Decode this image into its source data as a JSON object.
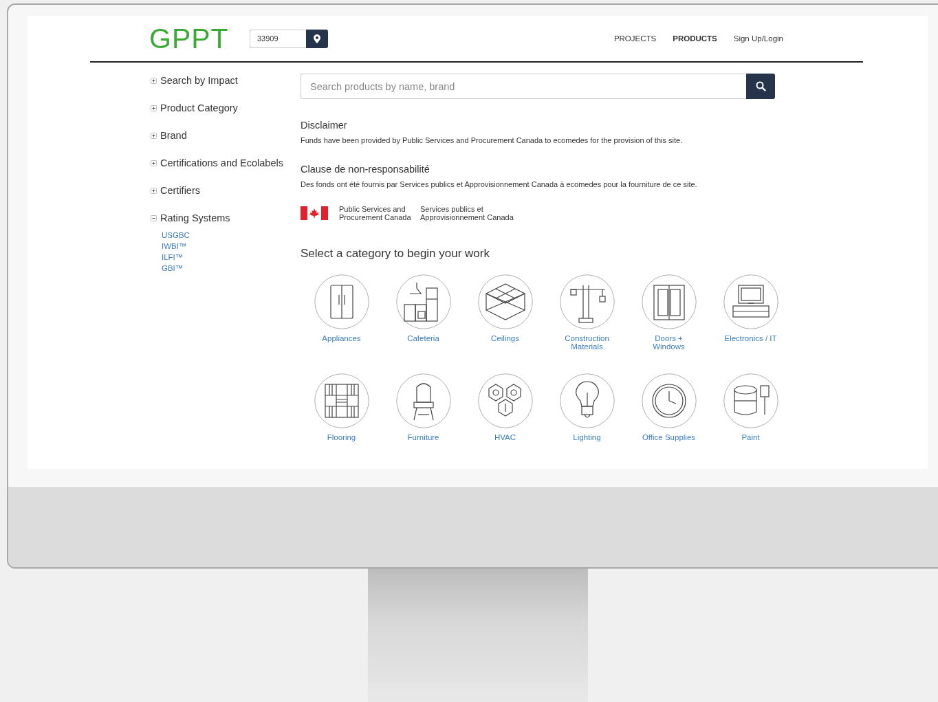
{
  "header": {
    "logo": "GPPT",
    "zip_field": {
      "value": "33909"
    },
    "nav": [
      {
        "label": "PROJECTS",
        "selected": false
      },
      {
        "label": "PRODUCTS",
        "selected": true
      },
      {
        "label": "Sign Up/Login",
        "selected": false
      }
    ]
  },
  "sidebar": {
    "items": [
      {
        "label": "Search by Impact",
        "expanded": false
      },
      {
        "label": "Product Category",
        "expanded": false
      },
      {
        "label": "Brand",
        "expanded": false
      },
      {
        "label": "Certifications and Ecolabels",
        "expanded": false
      },
      {
        "label": "Certifiers",
        "expanded": false
      },
      {
        "label": "Rating Systems",
        "expanded": true,
        "children": [
          {
            "label": "USGBC"
          },
          {
            "label": "IWBI™"
          },
          {
            "label": "ILFI™"
          },
          {
            "label": "GBI™"
          }
        ]
      }
    ]
  },
  "search": {
    "placeholder": "Search products by name, brand"
  },
  "disclaimers": [
    {
      "title": "Disclaimer",
      "text": "Funds have been provided by Public Services and Procurement Canada to ecomedes for the provision of this site."
    },
    {
      "title": "Clause de non-responsabilité",
      "text": "Des fonds ont été fournis par Services publics et Approvisionnement Canada à ecomedes pour la fourniture de ce site."
    }
  ],
  "government_logo": {
    "english": "Public Services and Procurement Canada",
    "french": "Services publics et Approvisionnement Canada"
  },
  "categories": {
    "title": "Select a category to begin your work",
    "items": [
      {
        "label": "Appliances"
      },
      {
        "label": "Cafeteria"
      },
      {
        "label": "Ceilings"
      },
      {
        "label": "Construction Materials"
      },
      {
        "label": "Doors + Windows"
      },
      {
        "label": "Electronics / IT"
      },
      {
        "label": "Flooring"
      },
      {
        "label": "Furniture"
      },
      {
        "label": "HVAC"
      },
      {
        "label": "Lighting"
      },
      {
        "label": "Office Supplies"
      },
      {
        "label": "Paint"
      }
    ]
  }
}
